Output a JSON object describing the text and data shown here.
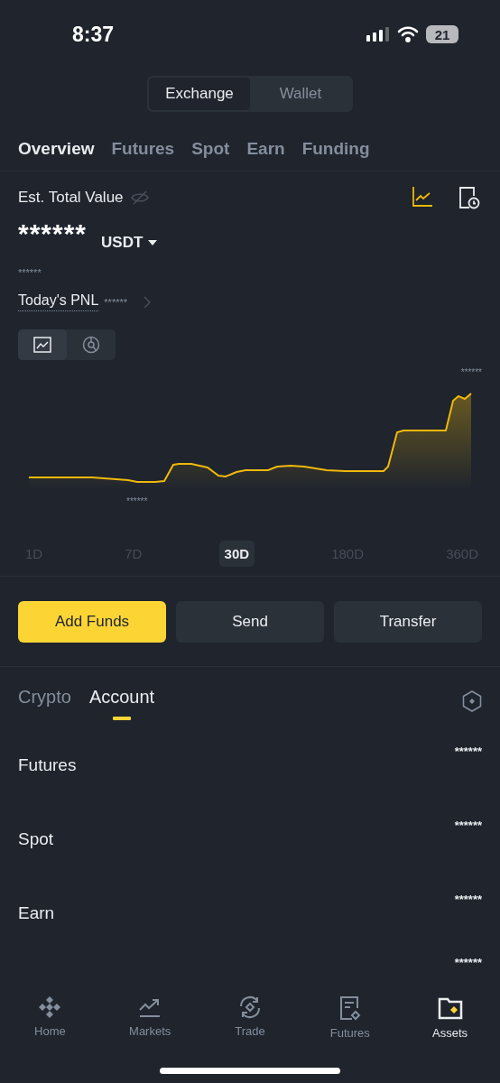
{
  "status_bar": {
    "time": "8:37",
    "battery": "21"
  },
  "segment": [
    {
      "label": "Exchange",
      "selected": true
    },
    {
      "label": "Wallet",
      "selected": false
    }
  ],
  "tabs": [
    {
      "label": "Overview",
      "selected": true
    },
    {
      "label": "Futures",
      "selected": false
    },
    {
      "label": "Spot",
      "selected": false
    },
    {
      "label": "Earn",
      "selected": false
    },
    {
      "label": "Funding",
      "selected": false
    }
  ],
  "summary": {
    "title": "Est. Total Value",
    "amount": "******",
    "currency": "USDT",
    "sub_amount": "******",
    "pnl_label": "Today's PNL",
    "pnl_value": "******"
  },
  "chart_toggle": [
    {
      "kind": "line",
      "selected": true
    },
    {
      "kind": "pie",
      "selected": false
    }
  ],
  "chart": {
    "max_label": "******",
    "min_label": "******"
  },
  "periods": [
    {
      "label": "1D",
      "selected": false
    },
    {
      "label": "7D",
      "selected": false
    },
    {
      "label": "30D",
      "selected": true
    },
    {
      "label": "180D",
      "selected": false
    },
    {
      "label": "360D",
      "selected": false
    }
  ],
  "actions": [
    {
      "label": "Add Funds",
      "primary": true
    },
    {
      "label": "Send",
      "primary": false
    },
    {
      "label": "Transfer",
      "primary": false
    }
  ],
  "section_tabs": [
    {
      "label": "Crypto",
      "selected": false
    },
    {
      "label": "Account",
      "selected": true
    }
  ],
  "accounts": [
    {
      "name": "Futures",
      "value": "******"
    },
    {
      "name": "Spot",
      "value": "******"
    },
    {
      "name": "Earn",
      "value": "******"
    },
    {
      "value": "******"
    }
  ],
  "nav": [
    {
      "label": "Home",
      "kind": "home",
      "selected": false
    },
    {
      "label": "Markets",
      "kind": "markets",
      "selected": false
    },
    {
      "label": "Trade",
      "kind": "trade",
      "selected": false
    },
    {
      "label": "Futures",
      "kind": "futures",
      "selected": false
    },
    {
      "label": "Assets",
      "kind": "assets",
      "selected": true
    }
  ]
}
